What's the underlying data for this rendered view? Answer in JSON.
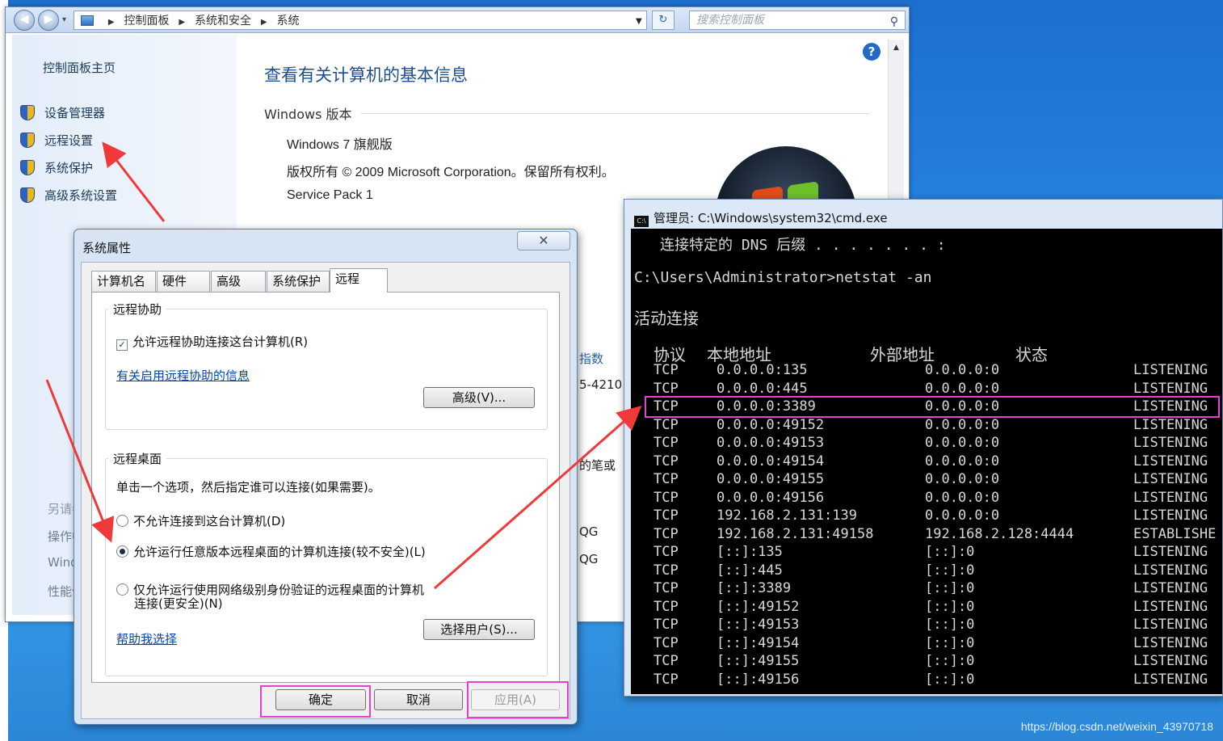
{
  "explorer": {
    "nav": {
      "back": "◀",
      "forward": "▶",
      "dropdown": "▾"
    },
    "breadcrumb": [
      "控制面板",
      "系统和安全",
      "系统"
    ],
    "search_placeholder": "搜索控制面板",
    "sidebar": {
      "home": "控制面板主页",
      "links": [
        "设备管理器",
        "远程设置",
        "系统保护",
        "高级系统设置"
      ],
      "see_also_title": "另请参",
      "see_also": [
        "操作中",
        "Wind",
        "性能信"
      ]
    },
    "main": {
      "title": "查看有关计算机的基本信息",
      "windows_version_heading": "Windows 版本",
      "edition": "Windows 7 旗舰版",
      "copyright": "版权所有 © 2009 Microsoft Corporation。保留所有权利。",
      "service_pack": "Service Pack 1",
      "partial_texts": [
        "指数",
        "5-4210",
        "的笔或",
        "QG",
        "QG"
      ]
    }
  },
  "sysprop": {
    "title": "系统属性",
    "tabs": [
      "计算机名",
      "硬件",
      "高级",
      "系统保护",
      "远程"
    ],
    "active_tab": "远程",
    "remote_assistance": {
      "group_title": "远程协助",
      "allow_checkbox_label": "允许远程协助连接这台计算机(R)",
      "allow_checked": true,
      "info_link": "有关启用远程协助的信息",
      "advanced_button": "高级(V)..."
    },
    "remote_desktop": {
      "group_title": "远程桌面",
      "description": "单击一个选项，然后指定谁可以连接(如果需要)。",
      "options": [
        {
          "label": "不允许连接到这台计算机(D)",
          "selected": false
        },
        {
          "label": "允许运行任意版本远程桌面的计算机连接(较不安全)(L)",
          "selected": true
        },
        {
          "label": "仅允许运行使用网络级别身份验证的远程桌面的计算机",
          "label_cont": "连接(更安全)(N)",
          "selected": false
        }
      ],
      "help_link": "帮助我选择",
      "select_users_button": "选择用户(S)..."
    },
    "buttons": {
      "ok": "确定",
      "cancel": "取消",
      "apply": "应用(A)"
    }
  },
  "cmd": {
    "title": "管理员: C:\\Windows\\system32\\cmd.exe",
    "dns_line": "连接特定的 DNS 后缀 . . . . . . . :",
    "prompt": "C:\\Users\\Administrator>netstat -an",
    "active_connections": "活动连接",
    "headers": [
      "协议",
      "本地地址",
      "外部地址",
      "状态"
    ],
    "rows": [
      [
        "TCP",
        "0.0.0.0:135",
        "0.0.0.0:0",
        "LISTENING"
      ],
      [
        "TCP",
        "0.0.0.0:445",
        "0.0.0.0:0",
        "LISTENING"
      ],
      [
        "TCP",
        "0.0.0.0:3389",
        "0.0.0.0:0",
        "LISTENING"
      ],
      [
        "TCP",
        "0.0.0.0:49152",
        "0.0.0.0:0",
        "LISTENING"
      ],
      [
        "TCP",
        "0.0.0.0:49153",
        "0.0.0.0:0",
        "LISTENING"
      ],
      [
        "TCP",
        "0.0.0.0:49154",
        "0.0.0.0:0",
        "LISTENING"
      ],
      [
        "TCP",
        "0.0.0.0:49155",
        "0.0.0.0:0",
        "LISTENING"
      ],
      [
        "TCP",
        "0.0.0.0:49156",
        "0.0.0.0:0",
        "LISTENING"
      ],
      [
        "TCP",
        "192.168.2.131:139",
        "0.0.0.0:0",
        "LISTENING"
      ],
      [
        "TCP",
        "192.168.2.131:49158",
        "192.168.2.128:4444",
        "ESTABLISHE"
      ],
      [
        "TCP",
        "[::]:135",
        "[::]:0",
        "LISTENING"
      ],
      [
        "TCP",
        "[::]:445",
        "[::]:0",
        "LISTENING"
      ],
      [
        "TCP",
        "[::]:3389",
        "[::]:0",
        "LISTENING"
      ],
      [
        "TCP",
        "[::]:49152",
        "[::]:0",
        "LISTENING"
      ],
      [
        "TCP",
        "[::]:49153",
        "[::]:0",
        "LISTENING"
      ],
      [
        "TCP",
        "[::]:49154",
        "[::]:0",
        "LISTENING"
      ],
      [
        "TCP",
        "[::]:49155",
        "[::]:0",
        "LISTENING"
      ],
      [
        "TCP",
        "[::]:49156",
        "[::]:0",
        "LISTENING"
      ]
    ]
  },
  "annotations": {
    "highlight_color": "#e63fd4",
    "arrow_color": "#f03a3a"
  },
  "watermark": "https://blog.csdn.net/weixin_43970718"
}
